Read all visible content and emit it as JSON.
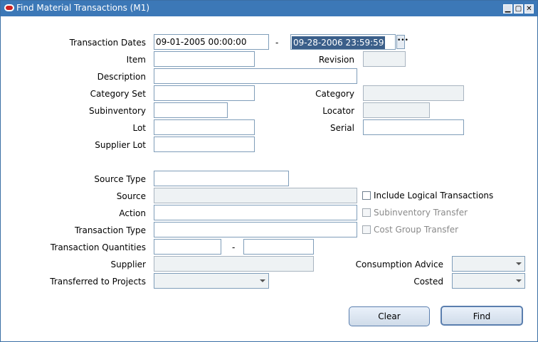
{
  "window": {
    "title": "Find Material Transactions (M1)",
    "minimize_glyph": "▁",
    "maximize_glyph": "▢",
    "close_glyph": "✕"
  },
  "form": {
    "transaction_dates": {
      "label": "Transaction Dates",
      "from": "09-01-2005 00:00:00",
      "separator": "-",
      "to": "09-28-2006 23:59:59",
      "lov_glyph": "•••"
    },
    "item": {
      "label": "Item",
      "value": ""
    },
    "revision": {
      "label": "Revision",
      "value": ""
    },
    "description": {
      "label": "Description",
      "value": ""
    },
    "category_set": {
      "label": "Category Set",
      "value": ""
    },
    "category": {
      "label": "Category",
      "value": ""
    },
    "subinventory": {
      "label": "Subinventory",
      "value": ""
    },
    "locator": {
      "label": "Locator",
      "value": ""
    },
    "lot": {
      "label": "Lot",
      "value": ""
    },
    "serial": {
      "label": "Serial",
      "value": ""
    },
    "supplier_lot": {
      "label": "Supplier Lot",
      "value": ""
    },
    "source_type": {
      "label": "Source Type",
      "value": ""
    },
    "source": {
      "label": "Source",
      "value": ""
    },
    "action": {
      "label": "Action",
      "value": ""
    },
    "transaction_type": {
      "label": "Transaction Type",
      "value": ""
    },
    "transaction_quantities": {
      "label": "Transaction Quantities",
      "from": "",
      "separator": "-",
      "to": ""
    },
    "supplier": {
      "label": "Supplier",
      "value": ""
    },
    "transferred_to_projects": {
      "label": "Transferred to Projects",
      "value": ""
    },
    "consumption_advice": {
      "label": "Consumption Advice",
      "value": ""
    },
    "costed": {
      "label": "Costed",
      "value": ""
    },
    "checkboxes": {
      "include_logical": {
        "label": "Include Logical Transactions",
        "checked": false,
        "enabled": true
      },
      "subinventory_transfer": {
        "label": "Subinventory Transfer",
        "checked": false,
        "enabled": false
      },
      "cost_group_transfer": {
        "label": "Cost Group Transfer",
        "checked": false,
        "enabled": false
      }
    }
  },
  "buttons": {
    "clear": "Clear",
    "find": "Find"
  }
}
